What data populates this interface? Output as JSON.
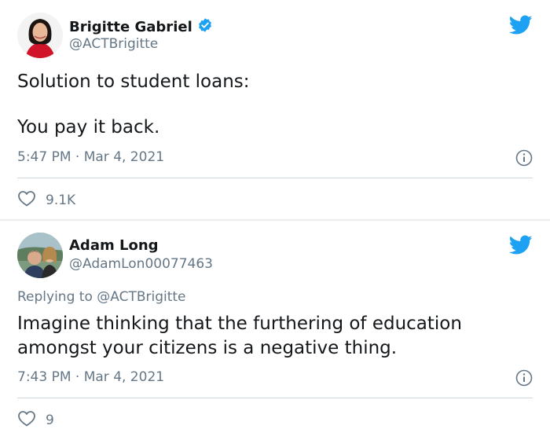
{
  "tweets": [
    {
      "name": "Brigitte Gabriel",
      "handle": "@ACTBrigitte",
      "verified": true,
      "text_line1": "Solution to student loans:",
      "text_line2": "You pay it back.",
      "time": "5:47 PM · Mar 4, 2021",
      "likes": "9.1K"
    },
    {
      "name": "Adam Long",
      "handle": "@AdamLon00077463",
      "verified": false,
      "replying_prefix": "Replying to ",
      "replying_handle": "@ACTBrigitte",
      "text_line1": "Imagine thinking that the furthering of education",
      "text_line2": "amongst your citizens is a negative thing.",
      "time": "7:43 PM · Mar 4, 2021",
      "likes": "9"
    }
  ],
  "colors": {
    "twitter_blue": "#1da1f2",
    "secondary_text": "#657786",
    "primary_text": "#14171a",
    "divider": "#ccd6dd"
  },
  "icons": [
    "avatar",
    "verified-badge-icon",
    "twitter-bird-icon",
    "info-icon",
    "heart-icon"
  ]
}
